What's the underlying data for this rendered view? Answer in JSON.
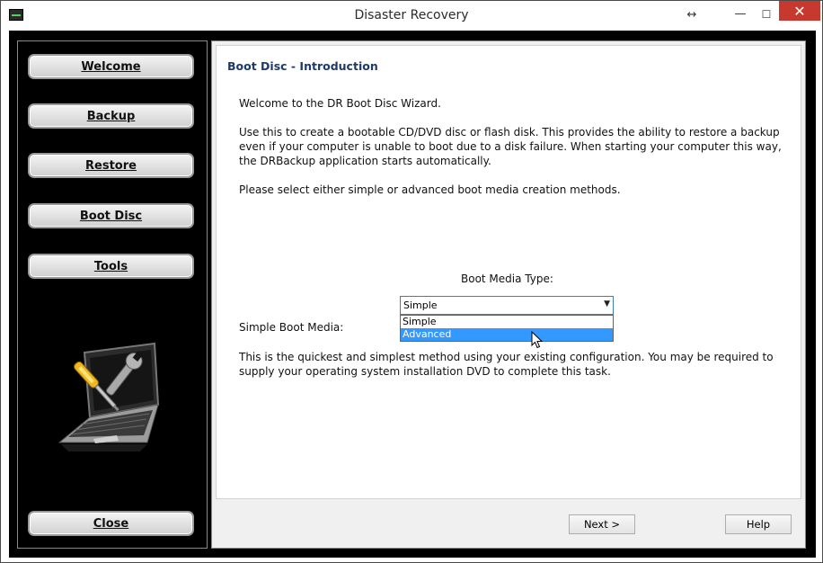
{
  "window": {
    "title": "Disaster Recovery",
    "resize_glyph": "↔",
    "minimize_glyph": "—",
    "maximize_glyph": "☐",
    "close_glyph": "✕",
    "close_color": "#c7382f"
  },
  "nav": {
    "welcome": "Welcome",
    "backup": "Backup",
    "restore": "Restore",
    "boot_disc": "Boot Disc",
    "tools": "Tools",
    "close": "Close"
  },
  "content": {
    "heading": "Boot Disc - Introduction",
    "paragraph1": "Welcome to the DR Boot Disc Wizard.",
    "paragraph2": "Use this to create a bootable CD/DVD disc or flash disk. This provides the ability to restore a backup even if your computer is unable to boot due to a disk failure. When starting your computer this way, the DRBackup application starts automatically.",
    "paragraph3": "Please select either simple or advanced boot media creation methods.",
    "boot_media_label": "Boot Media Type:",
    "select_value": "Simple",
    "options": [
      "Simple",
      "Advanced"
    ],
    "highlighted_option": "Advanced",
    "simple_label": "Simple Boot Media:",
    "paragraph4": "This is the quickest and simplest method using your existing configuration. You may be required to supply your operating system installation DVD to complete this task.",
    "next_button": "Next >",
    "help_button": "Help",
    "accent_color": "#3399ff",
    "heading_color": "#1e3a6b"
  }
}
